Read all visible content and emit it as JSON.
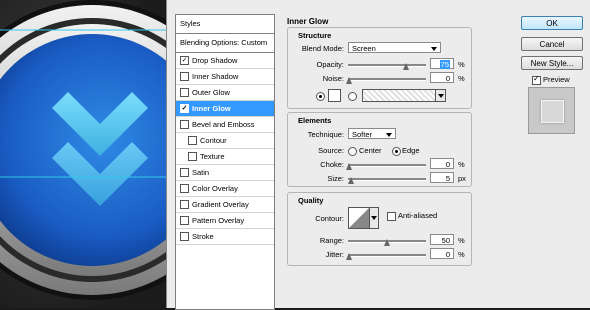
{
  "styles_panel": {
    "header": "Styles",
    "blending_options": "Blending Options: Custom",
    "items": [
      {
        "label": "Drop Shadow",
        "checked": true,
        "indent": false,
        "selected": false
      },
      {
        "label": "Inner Shadow",
        "checked": false,
        "indent": false,
        "selected": false
      },
      {
        "label": "Outer Glow",
        "checked": false,
        "indent": false,
        "selected": false
      },
      {
        "label": "Inner Glow",
        "checked": true,
        "indent": false,
        "selected": true
      },
      {
        "label": "Bevel and Emboss",
        "checked": false,
        "indent": false,
        "selected": false
      },
      {
        "label": "Contour",
        "checked": false,
        "indent": true,
        "selected": false
      },
      {
        "label": "Texture",
        "checked": false,
        "indent": true,
        "selected": false
      },
      {
        "label": "Satin",
        "checked": false,
        "indent": false,
        "selected": false
      },
      {
        "label": "Color Overlay",
        "checked": false,
        "indent": false,
        "selected": false
      },
      {
        "label": "Gradient Overlay",
        "checked": false,
        "indent": false,
        "selected": false
      },
      {
        "label": "Pattern Overlay",
        "checked": false,
        "indent": false,
        "selected": false
      },
      {
        "label": "Stroke",
        "checked": false,
        "indent": false,
        "selected": false
      }
    ]
  },
  "section_title": "Inner Glow",
  "structure": {
    "title": "Structure",
    "blend_mode_label": "Blend Mode:",
    "blend_mode_value": "Screen",
    "opacity_label": "Opacity:",
    "opacity_value": "75",
    "opacity_unit": "%",
    "noise_label": "Noise:",
    "noise_value": "0",
    "noise_unit": "%",
    "color_swatch": "#ffffff"
  },
  "elements": {
    "title": "Elements",
    "technique_label": "Technique:",
    "technique_value": "Softer",
    "source_label": "Source:",
    "source_center": "Center",
    "source_edge": "Edge",
    "choke_label": "Choke:",
    "choke_value": "0",
    "choke_unit": "%",
    "size_label": "Size:",
    "size_value": "5",
    "size_unit": "px"
  },
  "quality": {
    "title": "Quality",
    "contour_label": "Contour:",
    "anti_aliased_label": "Anti-aliased",
    "range_label": "Range:",
    "range_value": "50",
    "range_unit": "%",
    "jitter_label": "Jitter:",
    "jitter_value": "0",
    "jitter_unit": "%"
  },
  "buttons": {
    "ok": "OK",
    "cancel": "Cancel",
    "new_style": "New Style...",
    "preview_label": "Preview"
  },
  "colors": {
    "selection": "#3399ff",
    "canvas_blue": "#2a6fd6",
    "chevron_cyan": "#5fd0f0"
  }
}
